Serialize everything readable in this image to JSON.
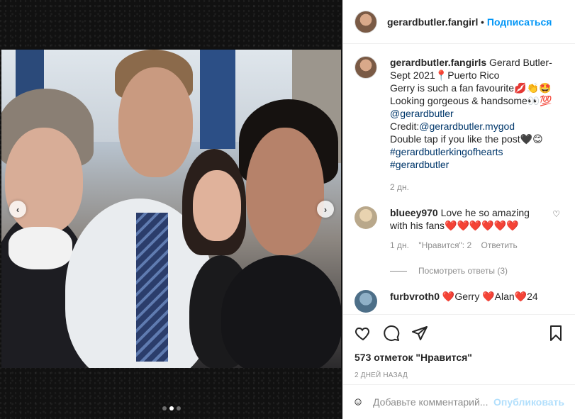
{
  "post": {
    "username": "gerardbutler.fangirl",
    "follow_label": "Подписаться",
    "separator": "•"
  },
  "caption": {
    "username": "gerardbutler.fangirls",
    "line1": "Gerard Butler-",
    "line2": "Sept 2021📍Puerto Rico",
    "line3": "Gerry is such a fan favourite💋👏🤩",
    "line4": "Looking gorgeous & handsome👀💯",
    "mention1": "@gerardbutler",
    "credit_prefix": "Credit:",
    "mention2": "@gerardbutler.mygod",
    "line7": "Double tap if you like the post🖤😊",
    "hashtag1": "#gerardbutlerkingofhearts",
    "hashtag2": "#gerardbutler",
    "time": "2 дн."
  },
  "comments": [
    {
      "username": "blueey970",
      "text": "Love he so amazing with his fans❤️❤️❤️❤️❤️❤️",
      "time": "1 дн.",
      "likes": "\"Нравится\": 2",
      "reply": "Ответить",
      "view_replies": "Посмотреть ответы (3)"
    },
    {
      "username": "furbvroth0",
      "text": "❤️Gerry ❤️Alan❤️24"
    }
  ],
  "actions": {
    "likes_count": "573 отметок \"Нравится\"",
    "post_time": "2 ДНЕЙ НАЗАД"
  },
  "comment_box": {
    "placeholder": "Добавьте комментарий...",
    "publish_label": "Опубликовать",
    "emoji_icon": "smile-icon"
  },
  "carousel": {
    "prev_icon": "chevron-left-icon",
    "next_icon": "chevron-right-icon",
    "slide_count": 3,
    "active_slide": 2
  },
  "colors": {
    "accent": "#0095f6",
    "link": "#00376b",
    "muted": "#8e8e8e",
    "heart": "#ed4956"
  }
}
